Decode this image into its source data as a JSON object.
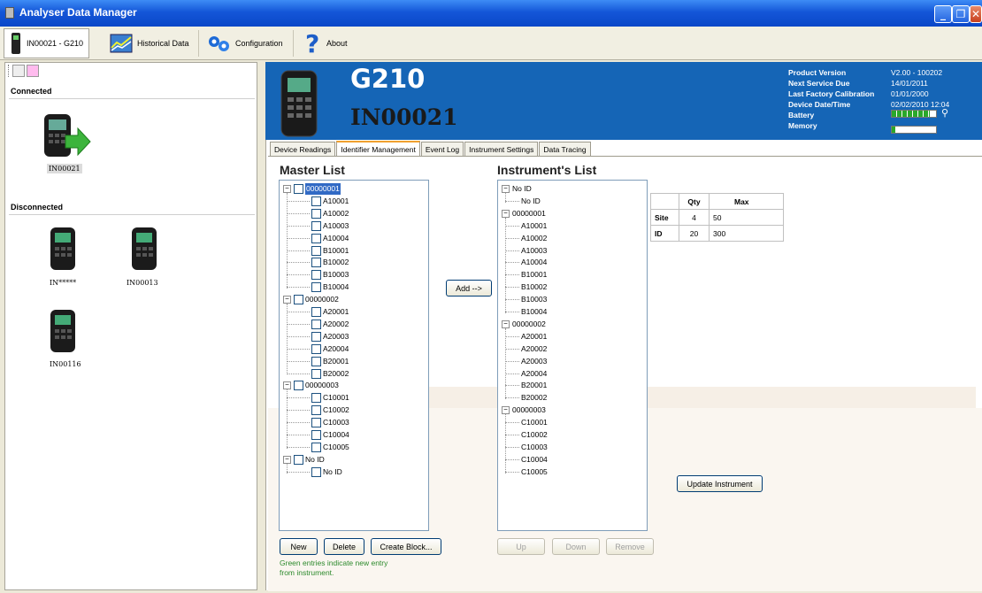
{
  "window": {
    "title": "Analyser Data Manager"
  },
  "toolbar": {
    "device_tab": "IN00021 - G210",
    "historical": "Historical Data",
    "configuration": "Configuration",
    "about": "About"
  },
  "left_panel": {
    "connected_label": "Connected",
    "disconnected_label": "Disconnected",
    "connected_devices": [
      "IN00021"
    ],
    "disconnected_devices": [
      "IN*****",
      "IN00013",
      "IN00116"
    ]
  },
  "header": {
    "model": "G210",
    "serial": "IN00021",
    "info": [
      {
        "label": "Product Version",
        "value": "V2.00 - 100202"
      },
      {
        "label": "Next Service Due",
        "value": "14/01/2011"
      },
      {
        "label": "Last Factory Calibration",
        "value": "01/01/2000"
      },
      {
        "label": "Device Date/Time",
        "value": "02/02/2010 12:04"
      },
      {
        "label": "Battery",
        "value": ""
      },
      {
        "label": "Memory",
        "value": ""
      }
    ],
    "battery_level": 0.85,
    "memory_level": 0.08
  },
  "tabs": [
    "Device Readings",
    "Identifier Management",
    "Event Log",
    "Instrument Settings",
    "Data Tracing"
  ],
  "master": {
    "title": "Master List",
    "groups": [
      {
        "id": "00000001",
        "items": [
          "A10001",
          "A10002",
          "A10003",
          "A10004",
          "B10001",
          "B10002",
          "B10003",
          "B10004"
        ]
      },
      {
        "id": "00000002",
        "items": [
          "A20001",
          "A20002",
          "A20003",
          "A20004",
          "B20001",
          "B20002"
        ]
      },
      {
        "id": "00000003",
        "items": [
          "C10001",
          "C10002",
          "C10003",
          "C10004",
          "C10005"
        ]
      },
      {
        "id": "No ID",
        "items": [
          "No ID"
        ]
      }
    ],
    "new": "New",
    "delete": "Delete",
    "create_block": "Create Block...",
    "note1": "Green entries indicate new entry",
    "note2": "from instrument."
  },
  "add_button": "Add -->",
  "instrument": {
    "title": "Instrument's List",
    "groups": [
      {
        "id": "No ID",
        "items": [
          "No ID"
        ]
      },
      {
        "id": "00000001",
        "items": [
          "A10001",
          "A10002",
          "A10003",
          "A10004",
          "B10001",
          "B10002",
          "B10003",
          "B10004"
        ]
      },
      {
        "id": "00000002",
        "items": [
          "A20001",
          "A20002",
          "A20003",
          "A20004",
          "B20001",
          "B20002"
        ]
      },
      {
        "id": "00000003",
        "items": [
          "C10001",
          "C10002",
          "C10003",
          "C10004",
          "C10005"
        ]
      }
    ],
    "up": "Up",
    "down": "Down",
    "remove": "Remove"
  },
  "qty_table": {
    "headers": [
      "",
      "Qty",
      "Max"
    ],
    "rows": [
      [
        "Site",
        "4",
        "50"
      ],
      [
        "ID",
        "20",
        "300"
      ]
    ]
  },
  "update_button": "Update Instrument"
}
